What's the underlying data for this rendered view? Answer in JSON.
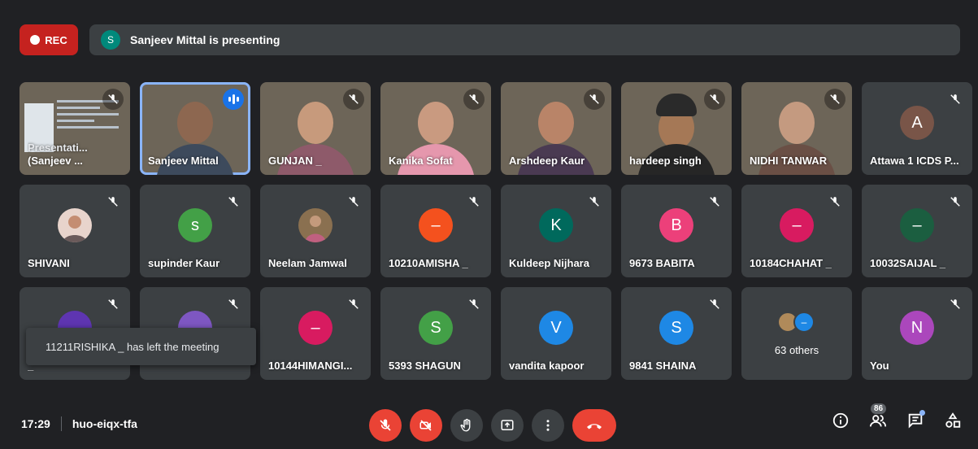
{
  "recording": {
    "label": "REC",
    "color": "#c5221f"
  },
  "presenting": {
    "avatar_letter": "S",
    "text": "Sanjeev Mittal is presenting"
  },
  "tiles": [
    {
      "name": "Presentati...",
      "name2": "(Sanjeev ...",
      "type": "presentation",
      "muted": true
    },
    {
      "name": "Sanjeev Mittal",
      "type": "video",
      "speaking": true
    },
    {
      "name": "GUNJAN _",
      "type": "video",
      "muted": true
    },
    {
      "name": "Kanika Sofat",
      "type": "video",
      "muted": true
    },
    {
      "name": "Arshdeep Kaur",
      "type": "video",
      "muted": true
    },
    {
      "name": "hardeep singh",
      "type": "video",
      "muted": true
    },
    {
      "name": "NIDHI TANWAR",
      "type": "video",
      "muted": true
    },
    {
      "name": "Attawa 1 ICDS P...",
      "avatar": "A",
      "avatar_color": "#795548",
      "muted": true
    },
    {
      "name": "SHIVANI",
      "avatar_photo": true,
      "muted": true
    },
    {
      "name": "supinder Kaur",
      "avatar": "s",
      "avatar_color": "#43a047",
      "muted": true
    },
    {
      "name": "Neelam Jamwal",
      "avatar_photo": true,
      "muted": true
    },
    {
      "name": "10210AMISHA _",
      "avatar": "–",
      "avatar_color": "#f4511e",
      "muted": true
    },
    {
      "name": "Kuldeep Nijhara",
      "avatar": "K",
      "avatar_color": "#00695c",
      "muted": true
    },
    {
      "name": "9673 BABITA",
      "avatar": "B",
      "avatar_color": "#ec407a",
      "muted": true
    },
    {
      "name": "10184CHAHAT _",
      "avatar": "–",
      "avatar_color": "#d81b60",
      "muted": true
    },
    {
      "name": "10032SAIJAL _",
      "avatar": "–",
      "avatar_color": "#1b5e40",
      "muted": true
    },
    {
      "name": "_",
      "avatar": "",
      "avatar_color": "#5e35b1",
      "muted": true
    },
    {
      "name": "",
      "avatar": "",
      "avatar_color": "#7e57c2",
      "muted": true
    },
    {
      "name": "10144HIMANGI...",
      "avatar": "–",
      "avatar_color": "#d81b60",
      "muted": true
    },
    {
      "name": "5393 SHAGUN",
      "avatar": "S",
      "avatar_color": "#43a047",
      "muted": true
    },
    {
      "name": "vandita kapoor",
      "avatar": "V",
      "avatar_color": "#1e88e5",
      "muted": true
    },
    {
      "name": "9841 SHAINA",
      "avatar": "S",
      "avatar_color": "#1e88e5",
      "muted": true
    },
    {
      "name": "63 others",
      "type": "others"
    },
    {
      "name": "You",
      "avatar": "N",
      "avatar_color": "#ab47bc",
      "muted": true
    }
  ],
  "toast": {
    "text": "11211RISHIKA _ has left the meeting"
  },
  "meeting": {
    "time": "17:29",
    "code": "huo-eiqx-tfa"
  },
  "controls": [
    "mic-off",
    "camera-off",
    "raise-hand",
    "present-screen",
    "more-options",
    "end-call"
  ],
  "right_panel": {
    "people_count": "86",
    "icons": [
      "info-icon",
      "people-icon",
      "chat-icon",
      "activities-icon"
    ]
  }
}
